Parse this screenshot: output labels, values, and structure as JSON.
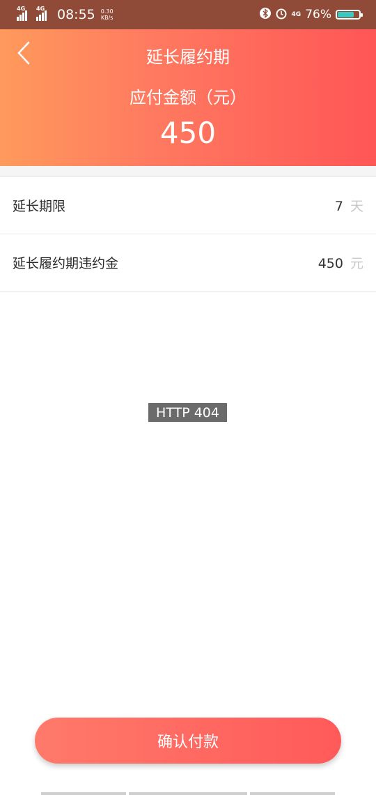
{
  "status_bar": {
    "network1": "4G",
    "network2": "4G",
    "time": "08:55",
    "speed_value": "0.30",
    "speed_unit": "KB/s",
    "network3": "4G",
    "battery": "76%"
  },
  "header": {
    "title": "延长履约期",
    "amount_label": "应付金额（元）",
    "amount": "450"
  },
  "rows": [
    {
      "label": "延长期限",
      "value": "7",
      "unit": "天"
    },
    {
      "label": "延长履约期违约金",
      "value": "450",
      "unit": "元"
    }
  ],
  "error_text": "HTTP 404",
  "confirm_button": "确认付款",
  "colors": {
    "gradient_start": "#ff9a5c",
    "gradient_end": "#ff5656",
    "button": "#ff6060"
  }
}
